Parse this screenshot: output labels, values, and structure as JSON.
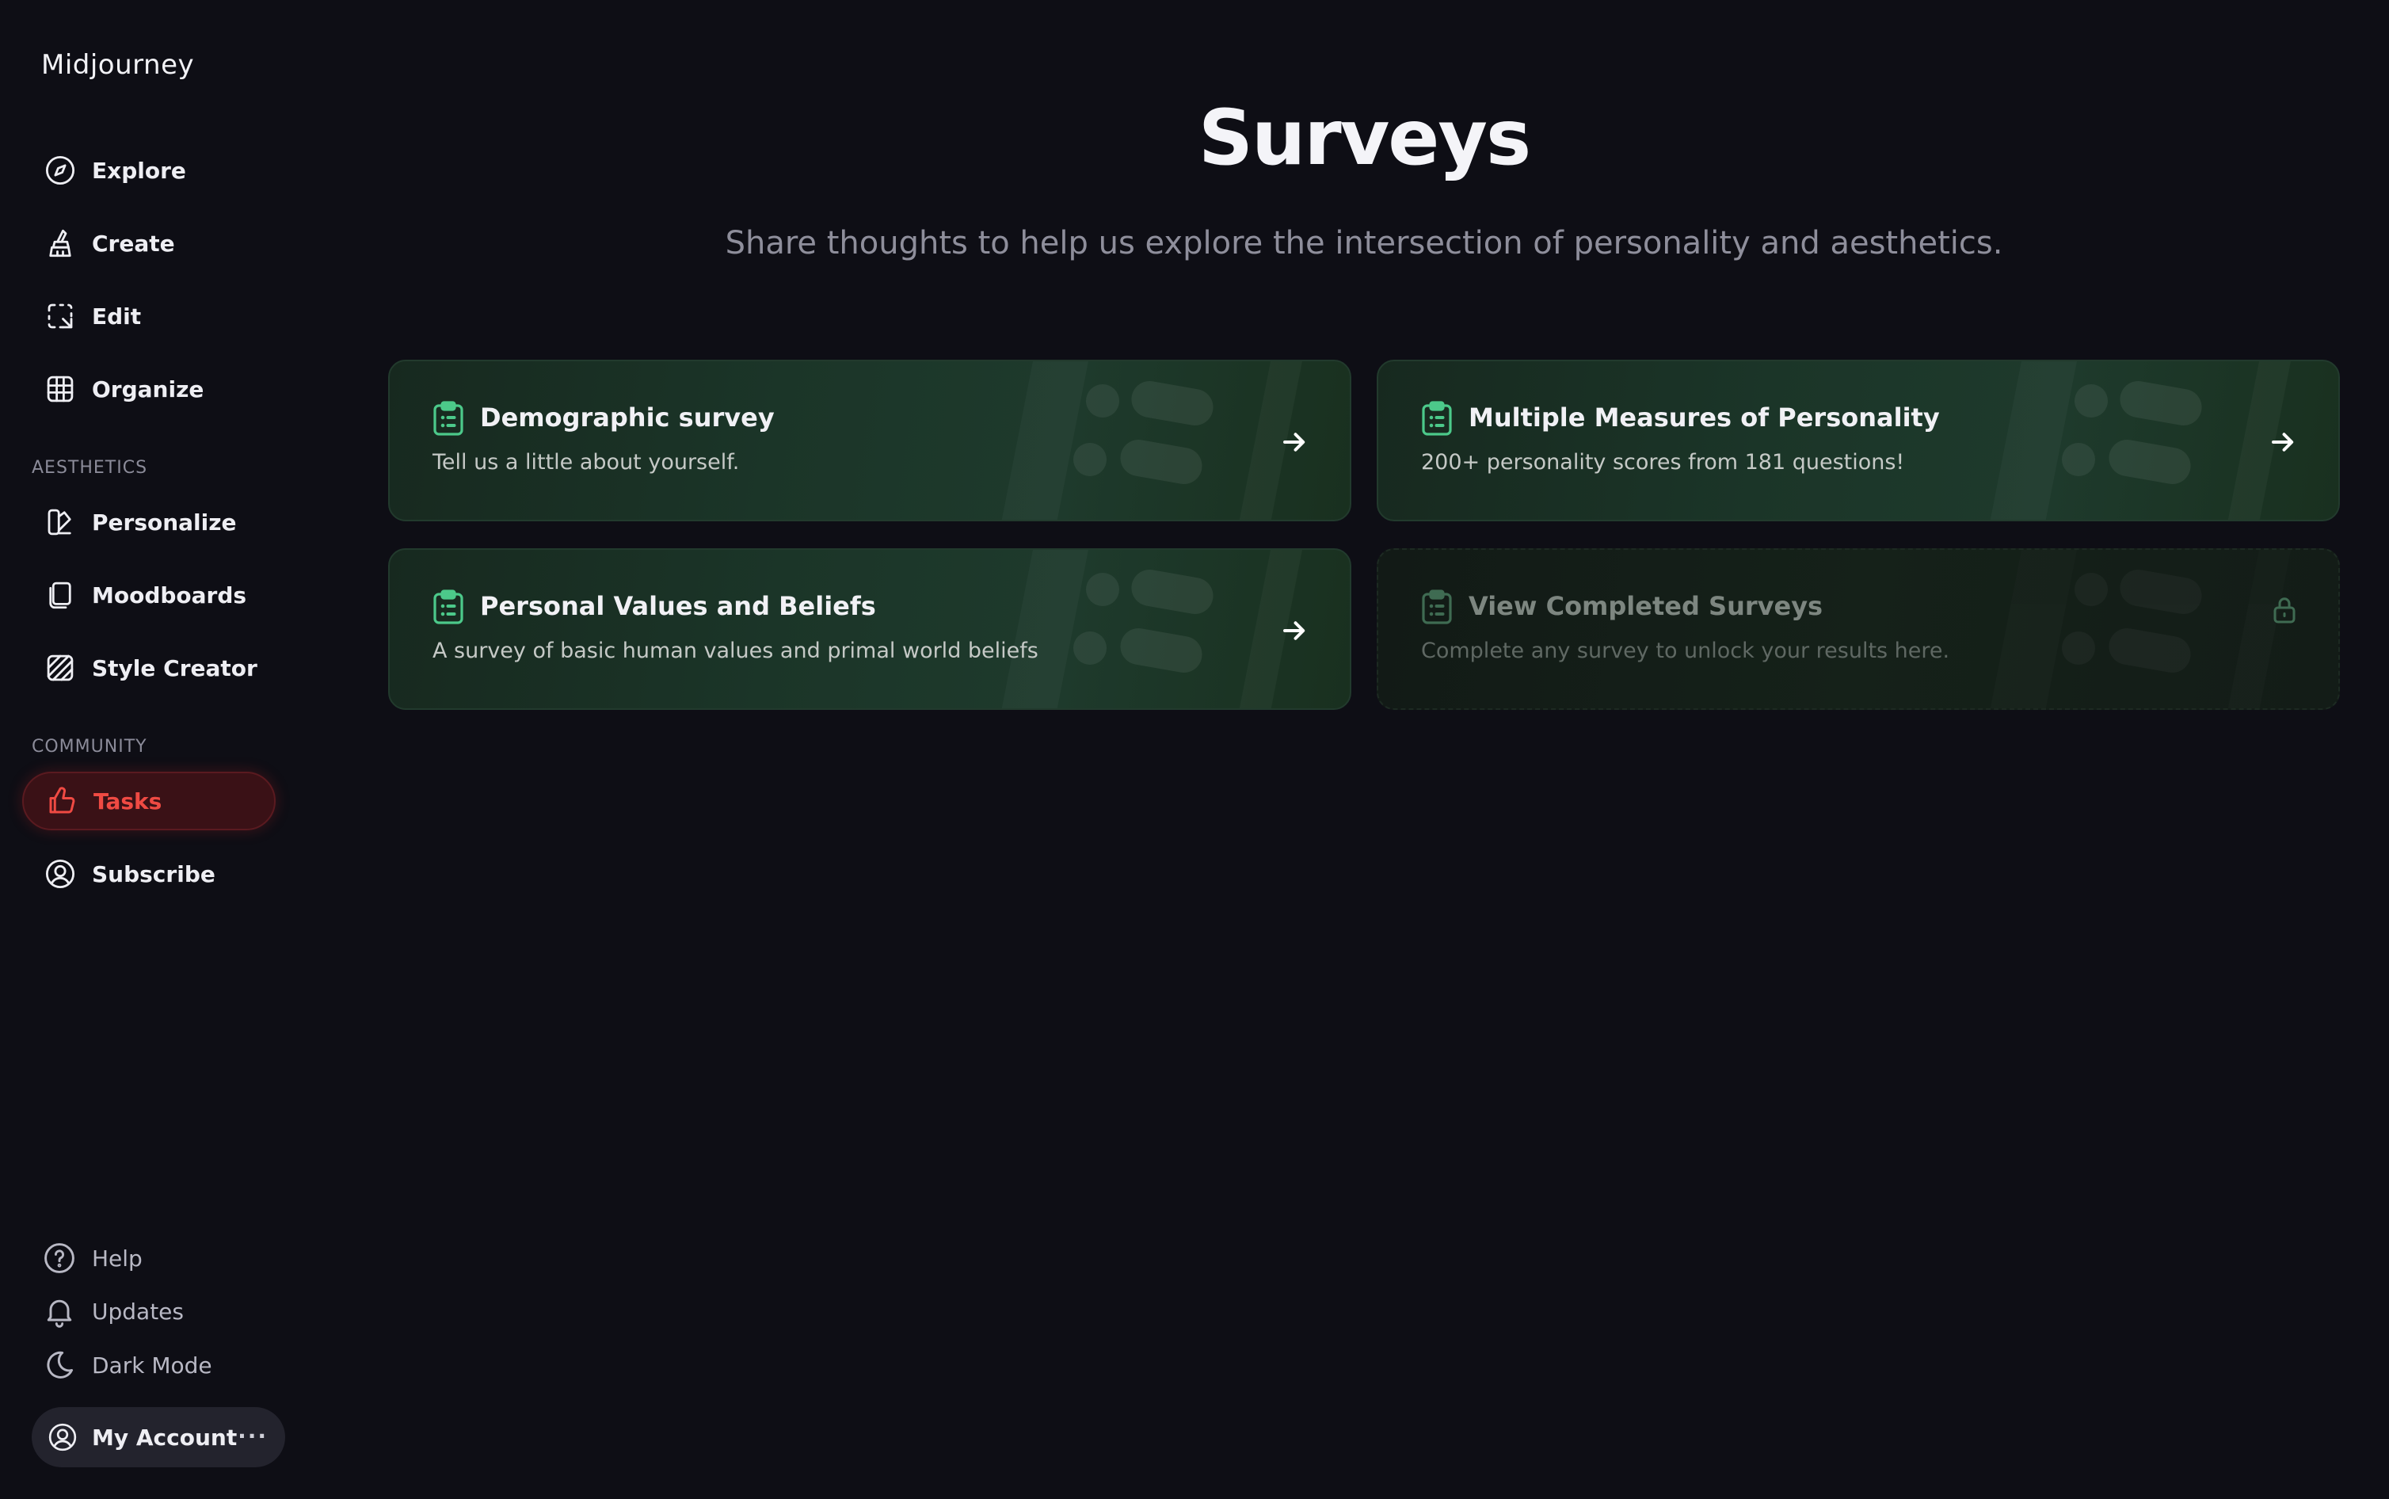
{
  "brand": "Midjourney",
  "nav": {
    "explore": "Explore",
    "create": "Create",
    "edit": "Edit",
    "organize": "Organize",
    "section_aesthetics": "AESTHETICS",
    "personalize": "Personalize",
    "moodboards": "Moodboards",
    "style_creator": "Style Creator",
    "section_community": "COMMUNITY",
    "tasks": "Tasks",
    "subscribe": "Subscribe"
  },
  "bottom": {
    "help": "Help",
    "updates": "Updates",
    "dark_mode": "Dark Mode",
    "account": "My Account",
    "more": "···"
  },
  "page": {
    "title": "Surveys",
    "subtitle": "Share thoughts to help us explore the intersection of personality and aesthetics."
  },
  "cards": [
    {
      "title": "Demographic survey",
      "desc": "Tell us a little about yourself."
    },
    {
      "title": "Multiple Measures of Personality",
      "desc": "200+ personality scores from 181 questions!"
    },
    {
      "title": "Personal Values and Beliefs",
      "desc": "A survey of basic human values and primal world beliefs"
    },
    {
      "title": "View Completed Surveys",
      "desc": "Complete any survey to unlock your results here."
    }
  ],
  "colors": {
    "background": "#0e0e15",
    "accent_active": "#ef4a43",
    "card_icon_green": "#4cc98a"
  }
}
